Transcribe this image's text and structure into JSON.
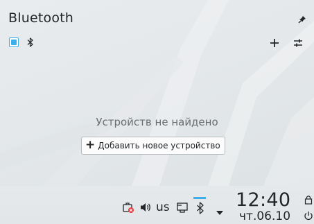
{
  "popup": {
    "title": "Bluetooth",
    "empty_message": "Устройств не найдено",
    "add_device_label": "Добавить новое устройство",
    "add_device_plus": "+"
  },
  "panel": {
    "keyboard_layout": "us",
    "clock_time": "12:40",
    "clock_date": "чт.06.10"
  },
  "icons": {
    "pin": "pin-icon",
    "bluetooth_toggle": "checkbox",
    "bluetooth": "bluetooth-icon",
    "add": "plus-icon",
    "configure": "sliders-icon",
    "briefcase": "briefcase-alert-icon",
    "volume": "speaker-icon",
    "clipboard": "clipboard-icon",
    "expand": "triangle-down-icon",
    "lock": "lock-icon",
    "power": "power-icon"
  },
  "colors": {
    "accent": "#3daee9",
    "alert": "#e93a3a",
    "text": "#232629",
    "muted_text": "#6b6e71"
  }
}
